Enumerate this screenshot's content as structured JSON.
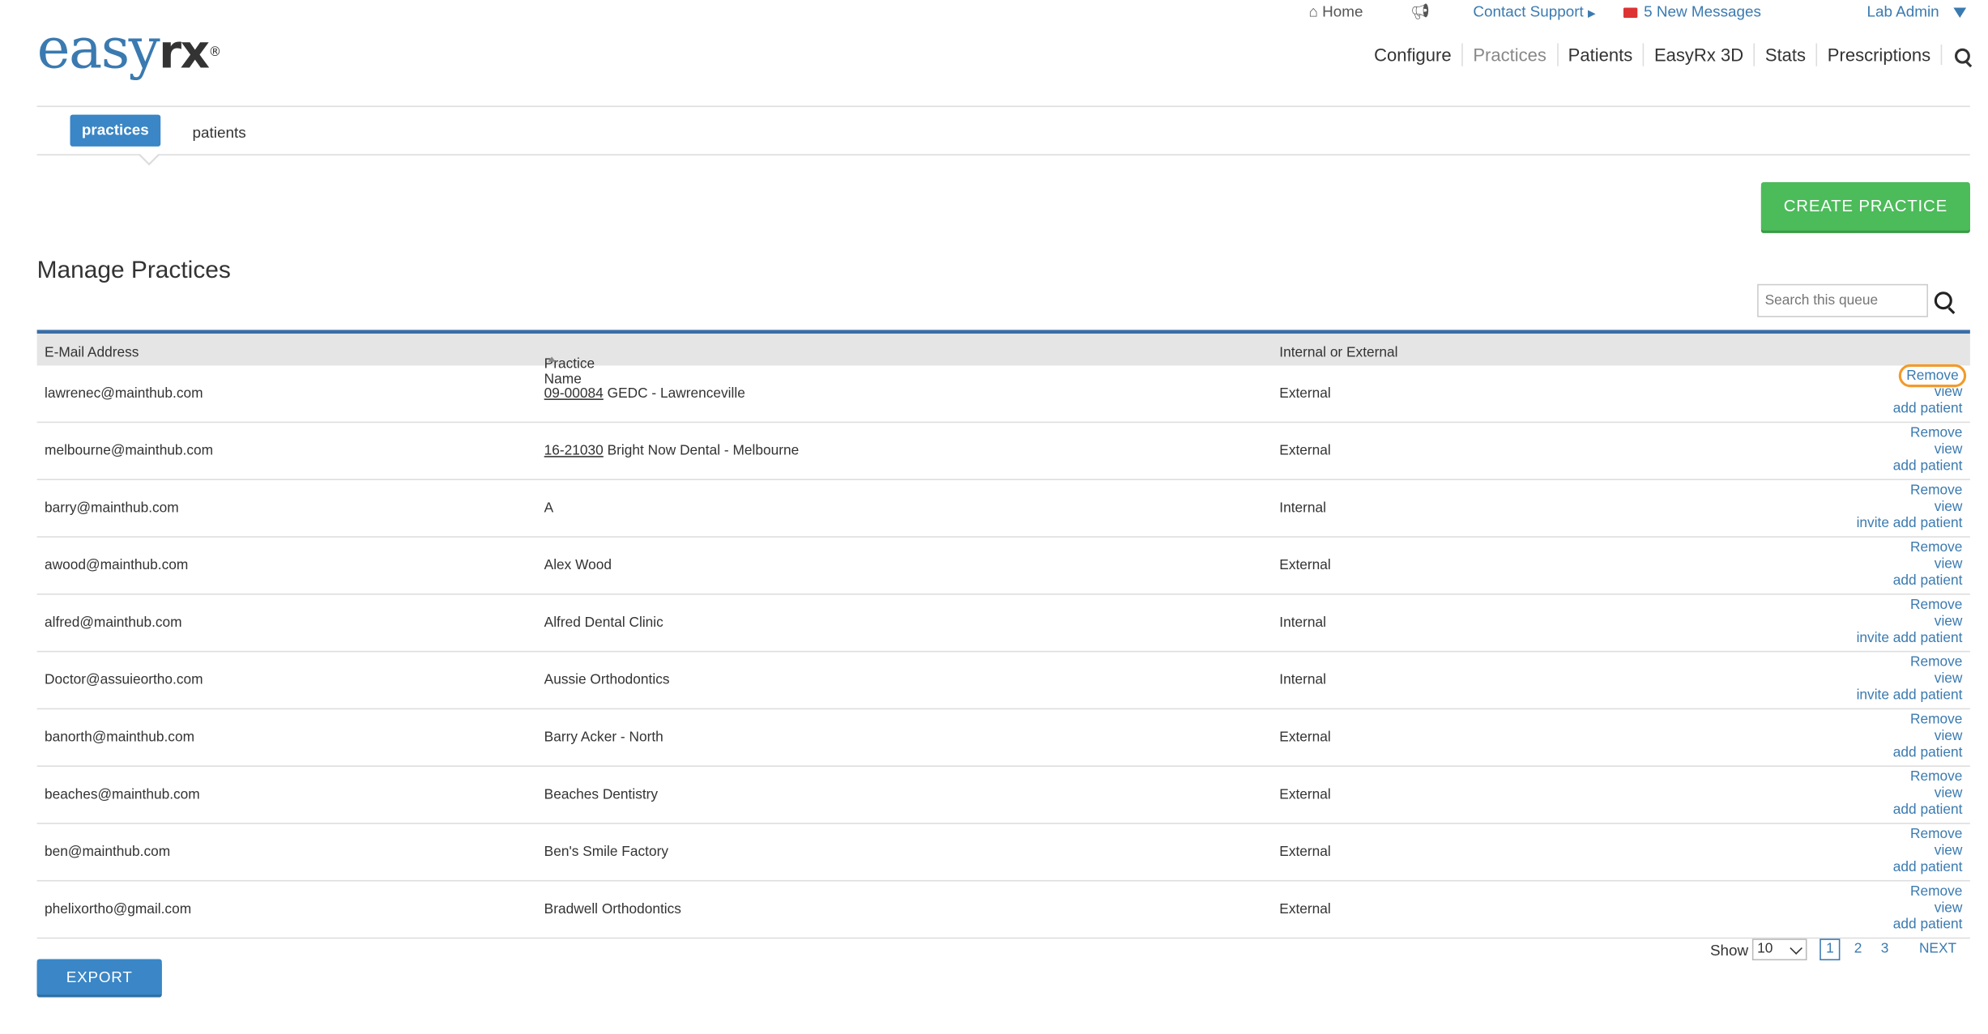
{
  "logo": {
    "text": "easy",
    "text2": "rx",
    "reg": "®"
  },
  "topbar": {
    "home_icon": "home-icon",
    "home": "Home",
    "announce_icon": "megaphone-icon",
    "contact": "Contact Support",
    "messages": "5 New Messages",
    "user": "Lab Admin"
  },
  "nav": {
    "items": [
      {
        "label": "Configure"
      },
      {
        "label": "Practices"
      },
      {
        "label": "Patients"
      },
      {
        "label": "EasyRx 3D"
      },
      {
        "label": "Stats"
      },
      {
        "label": "Prescriptions"
      }
    ]
  },
  "subtabs": {
    "active": "practices",
    "other": "patients"
  },
  "create_button": "CREATE PRACTICE",
  "page_title": "Manage Practices",
  "search": {
    "placeholder": "Search this queue"
  },
  "table": {
    "headers": [
      "E-Mail Address",
      "Practice Name",
      "Internal or External"
    ],
    "rows": [
      {
        "email": "lawrenec@mainthub.com",
        "code": "09-00084",
        "name": "GEDC - Lawrenceville",
        "type": "External",
        "a1": "Remove",
        "a2": "view",
        "a3": "add patient"
      },
      {
        "email": "melbourne@mainthub.com",
        "code": "16-21030",
        "name": "Bright Now Dental - Melbourne",
        "type": "External",
        "a1": "Remove",
        "a2": "view",
        "a3": "add patient"
      },
      {
        "email": "barry@mainthub.com",
        "code": "",
        "name": "A",
        "type": "Internal",
        "a1": "Remove",
        "a2": "view",
        "a3": "invite add patient"
      },
      {
        "email": "awood@mainthub.com",
        "code": "",
        "name": "Alex Wood",
        "type": "External",
        "a1": "Remove",
        "a2": "view",
        "a3": "add patient"
      },
      {
        "email": "alfred@mainthub.com",
        "code": "",
        "name": "Alfred Dental Clinic",
        "type": "Internal",
        "a1": "Remove",
        "a2": "view",
        "a3": "invite add patient"
      },
      {
        "email": "Doctor@assuieortho.com",
        "code": "",
        "name": "Aussie Orthodontics",
        "type": "Internal",
        "a1": "Remove",
        "a2": "view",
        "a3": "invite add patient"
      },
      {
        "email": "banorth@mainthub.com",
        "code": "",
        "name": "Barry Acker - North",
        "type": "External",
        "a1": "Remove",
        "a2": "view",
        "a3": "add patient"
      },
      {
        "email": "beaches@mainthub.com",
        "code": "",
        "name": "Beaches Dentistry",
        "type": "External",
        "a1": "Remove",
        "a2": "view",
        "a3": "add patient"
      },
      {
        "email": "ben@mainthub.com",
        "code": "",
        "name": "Ben's Smile Factory",
        "type": "External",
        "a1": "Remove",
        "a2": "view",
        "a3": "add patient"
      },
      {
        "email": "phelixortho@gmail.com",
        "code": "",
        "name": "Bradwell Orthodontics",
        "type": "External",
        "a1": "Remove",
        "a2": "view",
        "a3": "add patient"
      }
    ]
  },
  "export_button": "EXPORT",
  "pagination": {
    "show_label": "Show",
    "page_size": "10",
    "pages": [
      "1",
      "2",
      "3"
    ],
    "next": "NEXT"
  },
  "colors": {
    "accent": "#3a7ab0",
    "create": "#4cbb5a",
    "highlight": "#f39a2b"
  }
}
